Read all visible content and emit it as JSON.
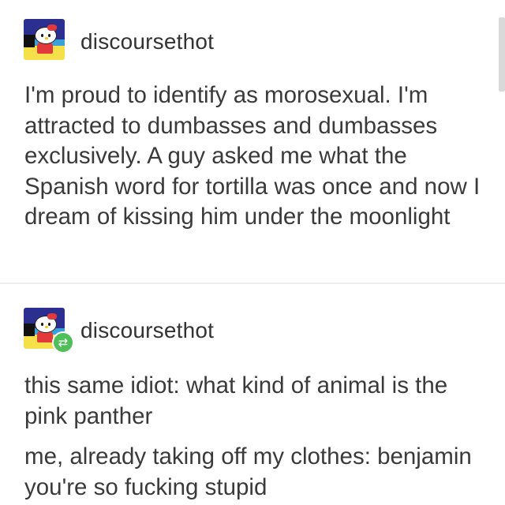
{
  "posts": [
    {
      "username": "discoursethot",
      "avatar_icon": "hello-kitty-avatar-icon",
      "body": "I'm proud to identify as morosexual. I'm attracted to dumbasses and dumbasses exclusively. A guy asked me what the Spanish word for tortilla was once and now I dream of kissing him under the moonlight"
    },
    {
      "username": "discoursethot",
      "avatar_icon": "hello-kitty-avatar-icon",
      "reblog_icon": "reblog-icon",
      "paragraphs": [
        "this same idiot: what kind of animal is the pink panther",
        "me, already taking off my clothes: benjamin you're so fucking stupid"
      ]
    }
  ],
  "colors": {
    "background": "#ffffff",
    "text": "#3a3a3a",
    "reblog_badge": "#4fbf5a",
    "divider": "#ececec"
  }
}
